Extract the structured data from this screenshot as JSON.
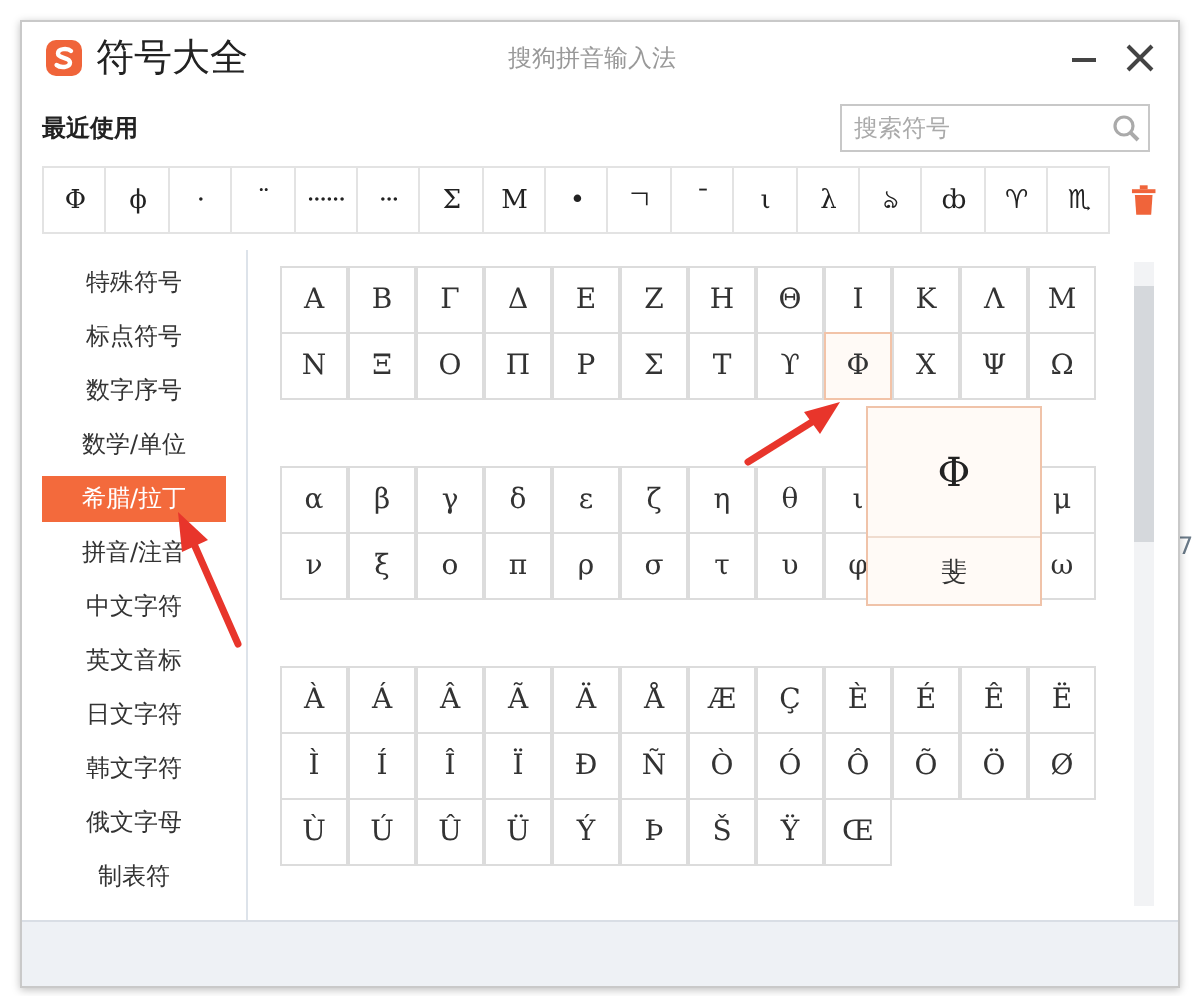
{
  "window": {
    "title": "符号大全",
    "subtitle": "搜狗拼音输入法"
  },
  "recent": {
    "label": "最近使用",
    "symbols": [
      "Φ",
      "ϕ",
      "·",
      "¨",
      "······",
      "···",
      "Σ",
      "Μ",
      "•",
      "ㄱ",
      "¯",
      "ι",
      "λ",
      "ঌ",
      "ȸ",
      "♈",
      "♏"
    ]
  },
  "search": {
    "placeholder": "搜索符号"
  },
  "sidebar": {
    "items": [
      {
        "label": "特殊符号",
        "selected": false
      },
      {
        "label": "标点符号",
        "selected": false
      },
      {
        "label": "数字序号",
        "selected": false
      },
      {
        "label": "数学/单位",
        "selected": false
      },
      {
        "label": "希腊/拉丁",
        "selected": true
      },
      {
        "label": "拼音/注音",
        "selected": false
      },
      {
        "label": "中文字符",
        "selected": false
      },
      {
        "label": "英文音标",
        "selected": false
      },
      {
        "label": "日文字符",
        "selected": false
      },
      {
        "label": "韩文字符",
        "selected": false
      },
      {
        "label": "俄文字母",
        "selected": false
      },
      {
        "label": "制表符",
        "selected": false
      }
    ]
  },
  "symbol_groups": [
    {
      "rows": [
        [
          {
            "symbol": "Α",
            "selected": false
          },
          {
            "symbol": "Β",
            "selected": false
          },
          {
            "symbol": "Γ",
            "selected": false
          },
          {
            "symbol": "Δ",
            "selected": false
          },
          {
            "symbol": "Ε",
            "selected": false
          },
          {
            "symbol": "Ζ",
            "selected": false
          },
          {
            "symbol": "Η",
            "selected": false
          },
          {
            "symbol": "Θ",
            "selected": false
          },
          {
            "symbol": "Ι",
            "selected": false
          },
          {
            "symbol": "Κ",
            "selected": false
          },
          {
            "symbol": "Λ",
            "selected": false
          },
          {
            "symbol": "Μ",
            "selected": false
          }
        ],
        [
          {
            "symbol": "Ν",
            "selected": false
          },
          {
            "symbol": "Ξ",
            "selected": false
          },
          {
            "symbol": "Ο",
            "selected": false
          },
          {
            "symbol": "Π",
            "selected": false
          },
          {
            "symbol": "Ρ",
            "selected": false
          },
          {
            "symbol": "Σ",
            "selected": false
          },
          {
            "symbol": "Τ",
            "selected": false
          },
          {
            "symbol": "ϒ",
            "selected": false
          },
          {
            "symbol": "Φ",
            "selected": true
          },
          {
            "symbol": "Χ",
            "selected": false
          },
          {
            "symbol": "Ψ",
            "selected": false
          },
          {
            "symbol": "Ω",
            "selected": false
          }
        ]
      ]
    },
    {
      "rows": [
        [
          {
            "symbol": "α",
            "selected": false
          },
          {
            "symbol": "β",
            "selected": false
          },
          {
            "symbol": "γ",
            "selected": false
          },
          {
            "symbol": "δ",
            "selected": false
          },
          {
            "symbol": "ε",
            "selected": false
          },
          {
            "symbol": "ζ",
            "selected": false
          },
          {
            "symbol": "η",
            "selected": false
          },
          {
            "symbol": "θ",
            "selected": false
          },
          {
            "symbol": "ι",
            "selected": false
          },
          null,
          null,
          {
            "symbol": "μ",
            "selected": false
          }
        ],
        [
          {
            "symbol": "ν",
            "selected": false
          },
          {
            "symbol": "ξ",
            "selected": false
          },
          {
            "symbol": "ο",
            "selected": false
          },
          {
            "symbol": "π",
            "selected": false
          },
          {
            "symbol": "ρ",
            "selected": false
          },
          {
            "symbol": "σ",
            "selected": false
          },
          {
            "symbol": "τ",
            "selected": false
          },
          {
            "symbol": "υ",
            "selected": false
          },
          {
            "symbol": "φ",
            "selected": false
          },
          null,
          null,
          {
            "symbol": "ω",
            "selected": false
          }
        ]
      ]
    },
    {
      "rows": [
        [
          {
            "symbol": "À",
            "selected": false
          },
          {
            "symbol": "Á",
            "selected": false
          },
          {
            "symbol": "Â",
            "selected": false
          },
          {
            "symbol": "Ã",
            "selected": false
          },
          {
            "symbol": "Ä",
            "selected": false
          },
          {
            "symbol": "Å",
            "selected": false
          },
          {
            "symbol": "Æ",
            "selected": false
          },
          {
            "symbol": "Ç",
            "selected": false
          },
          {
            "symbol": "È",
            "selected": false
          },
          {
            "symbol": "É",
            "selected": false
          },
          {
            "symbol": "Ê",
            "selected": false
          },
          {
            "symbol": "Ë",
            "selected": false
          }
        ],
        [
          {
            "symbol": "Ì",
            "selected": false
          },
          {
            "symbol": "Í",
            "selected": false
          },
          {
            "symbol": "Î",
            "selected": false
          },
          {
            "symbol": "Ï",
            "selected": false
          },
          {
            "symbol": "Ð",
            "selected": false
          },
          {
            "symbol": "Ñ",
            "selected": false
          },
          {
            "symbol": "Ò",
            "selected": false
          },
          {
            "symbol": "Ó",
            "selected": false
          },
          {
            "symbol": "Ô",
            "selected": false
          },
          {
            "symbol": "Õ",
            "selected": false
          },
          {
            "symbol": "Ö",
            "selected": false
          },
          {
            "symbol": "Ø",
            "selected": false
          }
        ],
        [
          {
            "symbol": "Ù",
            "selected": false
          },
          {
            "symbol": "Ú",
            "selected": false
          },
          {
            "symbol": "Û",
            "selected": false
          },
          {
            "symbol": "Ü",
            "selected": false
          },
          {
            "symbol": "Ý",
            "selected": false
          },
          {
            "symbol": "Þ",
            "selected": false
          },
          {
            "symbol": "Š",
            "selected": false
          },
          {
            "symbol": "Ÿ",
            "selected": false
          },
          {
            "symbol": "Œ",
            "selected": false
          }
        ]
      ]
    }
  ],
  "tooltip": {
    "symbol": "Φ",
    "reading": "斐"
  },
  "background_text": "7"
}
